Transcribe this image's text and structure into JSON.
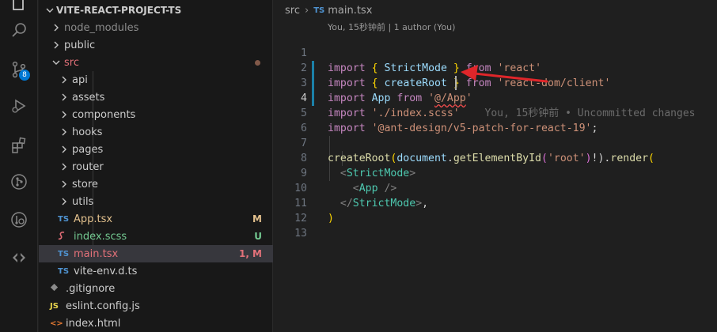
{
  "sidebar": {
    "root_title": "VITE-REACT-PROJECT-TS",
    "items": [
      {
        "label": "node_modules",
        "icon": "chevron-right-icon"
      },
      {
        "label": "public",
        "icon": "chevron-right-icon"
      },
      {
        "label": "src",
        "icon": "chevron-down-icon"
      },
      {
        "label": "api",
        "icon": "chevron-right-icon"
      },
      {
        "label": "assets",
        "icon": "chevron-right-icon"
      },
      {
        "label": "components",
        "icon": "chevron-right-icon"
      },
      {
        "label": "hooks",
        "icon": "chevron-right-icon"
      },
      {
        "label": "pages",
        "icon": "chevron-right-icon"
      },
      {
        "label": "router",
        "icon": "chevron-right-icon"
      },
      {
        "label": "store",
        "icon": "chevron-right-icon"
      },
      {
        "label": "utils",
        "icon": "chevron-right-icon"
      },
      {
        "label": "App.tsx",
        "badge": "TS",
        "status": "M"
      },
      {
        "label": "index.scss",
        "badge": "scss",
        "status": "U"
      },
      {
        "label": "main.tsx",
        "badge": "TS",
        "status": "1, M"
      },
      {
        "label": "vite-env.d.ts",
        "badge": "TS"
      },
      {
        "label": ".gitignore",
        "badge": "git"
      },
      {
        "label": "eslint.config.js",
        "badge": "JS"
      },
      {
        "label": "index.html",
        "badge": "<>"
      }
    ],
    "ts_badge": "TS",
    "js_badge": "JS"
  },
  "activity_bar": {
    "source_control_badge": "8"
  },
  "editor": {
    "breadcrumb": {
      "folder": "src",
      "file": "main.tsx",
      "file_badge": "TS"
    },
    "codelens": "You, 15秒钟前 | 1 author (You)",
    "line_numbers": [
      "1",
      "2",
      "3",
      "4",
      "5",
      "6",
      "7",
      "8",
      "9",
      "10",
      "11",
      "12",
      "13"
    ],
    "lines": {
      "l1": {
        "kw1": "import",
        "b1": "{",
        "id": "StrictMode",
        "b2": "}",
        "kw2": "from",
        "str": "'react'"
      },
      "l2": {
        "kw1": "import",
        "b1": "{",
        "id": "createRoot",
        "b2": "}",
        "kw2": "from",
        "str": "'react-dom/client'"
      },
      "l3": {
        "kw1": "import",
        "id": "App",
        "kw2": "from",
        "str_q1": "'",
        "str_at": "@/App",
        "str_q2": "'"
      },
      "l4": {
        "kw1": "import",
        "str": "'./index.scss'",
        "blame": "You, 15秒钟前 • Uncommitted changes"
      },
      "l5": {
        "kw1": "import",
        "str": "'@ant-design/v5-patch-for-react-19'",
        "semi": ";"
      },
      "l7": {
        "fn1": "createRoot",
        "p1": "(",
        "id": "document",
        "dot1": ".",
        "fn2": "getElementById",
        "p2": "(",
        "str": "'root'",
        "p3": ")",
        "rest": "!).",
        "fn3": "render",
        "p4": "("
      },
      "l8": {
        "open": "<",
        "comp": "StrictMode",
        "close": ">"
      },
      "l9": {
        "open": "<",
        "comp": "App",
        "close": " />"
      },
      "l10": {
        "open": "</",
        "comp": "StrictMode",
        "close": ">",
        "tail": ","
      },
      "l11": {
        "p": ")"
      }
    }
  },
  "colors": {
    "accent": "#0078d4",
    "arrow": "#e0262a",
    "modified": "#e2c08d",
    "untracked": "#73c991",
    "error_status": "#e37179"
  }
}
